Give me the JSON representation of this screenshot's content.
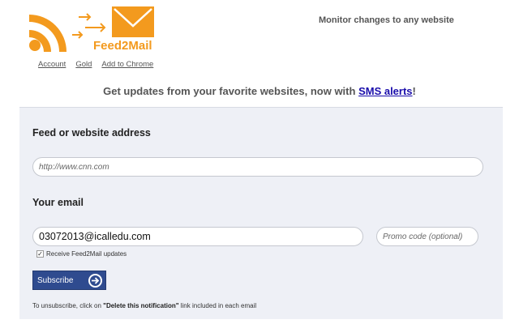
{
  "header": {
    "logo_text": "Feed2Mail",
    "tagline": "Monitor changes to any website"
  },
  "nav": {
    "items": [
      "Account",
      "Gold",
      "Add to Chrome"
    ]
  },
  "headline": {
    "prefix": "Get updates from your favorite websites, now with ",
    "link": "SMS alerts",
    "suffix": "!"
  },
  "form": {
    "feed_label": "Feed or website address",
    "feed_placeholder": "http://www.cnn.com",
    "email_label": "Your email",
    "email_value": "03072013@icalledu.com",
    "promo_placeholder": "Promo code (optional)",
    "checkbox_label": "Receive Feed2Mail updates",
    "checkbox_checked": true,
    "checkbox_mark": "✓",
    "subscribe_label": "Subscribe",
    "unsub_prefix": "To unsubscribe, click on ",
    "unsub_bold": "\"Delete this notification\"",
    "unsub_suffix": " link included in each email"
  },
  "colors": {
    "brand_orange": "#f39a1e",
    "button_blue": "#2f4b8f",
    "panel_bg": "#eef0f6"
  }
}
